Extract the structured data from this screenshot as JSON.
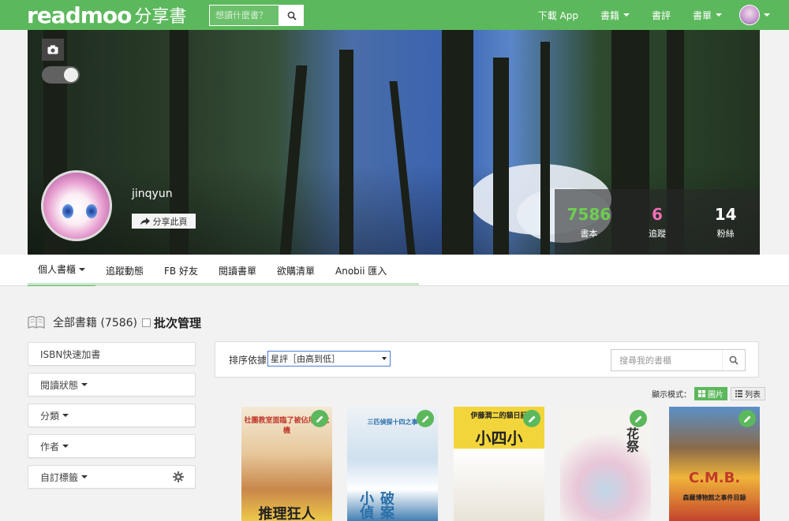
{
  "header": {
    "logo_en": "readmoo",
    "logo_zh": "分享書",
    "search_placeholder": "想讀什麼書？",
    "nav": [
      {
        "label": "下載 App",
        "caret": false
      },
      {
        "label": "書籍",
        "caret": true
      },
      {
        "label": "書評",
        "caret": false
      },
      {
        "label": "書單",
        "caret": true
      }
    ]
  },
  "profile": {
    "username": "jinqyun",
    "share_label": "分享此頁",
    "stats": [
      {
        "value": "7586",
        "label": "書本",
        "color": "#6ccf4f"
      },
      {
        "value": "6",
        "label": "追蹤",
        "color": "#f06fb4"
      },
      {
        "value": "14",
        "label": "粉絲",
        "color": "#ffffff"
      }
    ]
  },
  "tabs": [
    {
      "label": "個人書櫃",
      "caret": true
    },
    {
      "label": "追蹤動態",
      "caret": false
    },
    {
      "label": "FB 好友",
      "caret": false
    },
    {
      "label": "閱讀書單",
      "caret": false
    },
    {
      "label": "欲購清單",
      "caret": false
    },
    {
      "label": "Anobii 匯入",
      "caret": false
    }
  ],
  "heading": {
    "all_books": "全部書籍 (7586)",
    "batch": "批次管理"
  },
  "sidebar": [
    {
      "label": "ISBN快速加書",
      "caret": false
    },
    {
      "label": "閱讀狀態",
      "caret": true
    },
    {
      "label": "分類",
      "caret": true
    },
    {
      "label": "作者",
      "caret": true
    },
    {
      "label": "自訂標籤",
      "caret": true
    }
  ],
  "sort": {
    "label": "排序依據",
    "selected": "星評［由高到低］",
    "search_placeholder": "搜尋我的書櫃"
  },
  "display_mode": {
    "label": "顯示模式：",
    "grid": "圖片",
    "list": "列表"
  },
  "books": [
    {
      "title": "社團教室面臨了被佔用的危機",
      "big": "推理狂人",
      "bg": "#e8a23a"
    },
    {
      "title": "三匹偵探十四之事",
      "big": "破案小偵",
      "bg": "#2a6fa8"
    },
    {
      "title": "伊藤潤二的貓日記",
      "big": "小四小",
      "bg": "#f2d53a"
    },
    {
      "title": "",
      "big": "花祭",
      "bg": "#f5f3ef"
    },
    {
      "title": "森羅博物館之事件目錄",
      "big": "C.M.B.",
      "bg": "#3a8ac8"
    }
  ]
}
